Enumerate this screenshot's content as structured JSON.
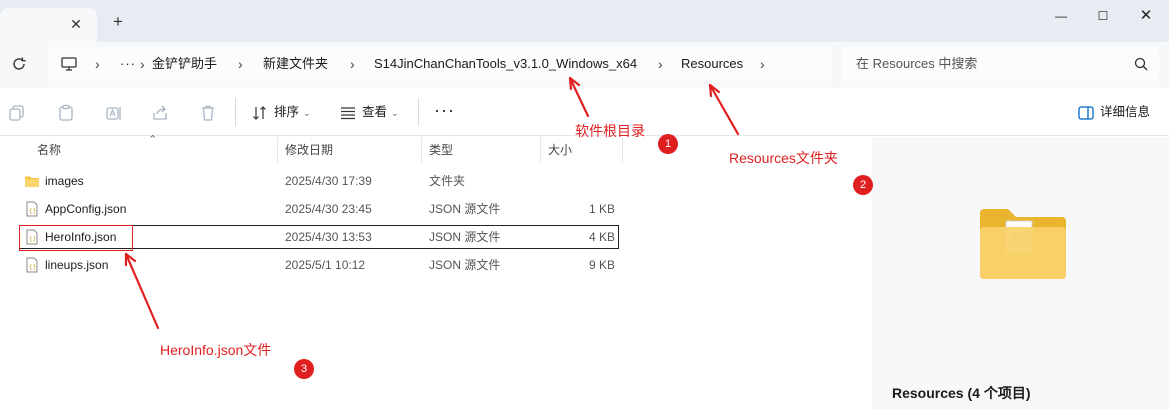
{
  "tabbar": {
    "close_glyph": "✕",
    "new_tab_glyph": "+",
    "window": {
      "minimize": "—",
      "maximize": "☐",
      "close": "✕"
    }
  },
  "address": {
    "more": "···",
    "crumbs": [
      "金铲铲助手",
      "新建文件夹",
      "S14JinChanChanTools_v3.1.0_Windows_x64",
      "Resources"
    ],
    "separator": "›"
  },
  "search": {
    "placeholder": "在 Resources 中搜索"
  },
  "toolbar": {
    "sort_label": "排序",
    "view_label": "查看",
    "more_label": "···",
    "details_label": "详细信息",
    "caret": "⌄"
  },
  "columns": {
    "name": "名称",
    "date": "修改日期",
    "type": "类型",
    "size": "大小"
  },
  "files": [
    {
      "name": "images",
      "date": "2025/4/30 17:39",
      "type": "文件夹",
      "size": "",
      "icon": "folder-icon"
    },
    {
      "name": "AppConfig.json",
      "date": "2025/4/30 23:45",
      "type": "JSON 源文件",
      "size": "1 KB",
      "icon": "json-file-icon"
    },
    {
      "name": "HeroInfo.json",
      "date": "2025/4/30 13:53",
      "type": "JSON 源文件",
      "size": "4 KB",
      "icon": "json-file-icon"
    },
    {
      "name": "lineups.json",
      "date": "2025/5/1 10:12",
      "type": "JSON 源文件",
      "size": "9 KB",
      "icon": "json-file-icon"
    }
  ],
  "preview": {
    "title": "Resources (4 个项目)"
  },
  "annotations": {
    "root_dir": "软件根目录",
    "resources_folder": "Resources文件夹",
    "heroinfo_file": "HeroInfo.json文件",
    "n1": "1",
    "n2": "2",
    "n3": "3",
    "color": "#e02020"
  },
  "colors": {
    "folder": "#f5c344",
    "accent": "#0067c0",
    "tabbar": "#e8ebf1"
  }
}
